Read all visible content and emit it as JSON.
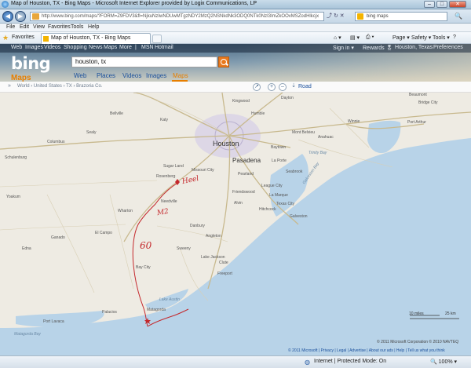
{
  "window": {
    "title": "Map of Houston, TX - Bing Maps - Microsoft Internet Explorer provided by Logix Communications, LP",
    "min": "–",
    "max": "□",
    "close": "✕"
  },
  "address": {
    "url": "http://www.bing.com/maps/?FORM=Z9FDV3&fl=NjkuNzIwNDUwMTgzNDY2MzQ2NSNkdNk3ODQ0NTk0NzI3ImZkOOvMSZodHlkcjx",
    "search_placeholder": "bing maps",
    "back": "◀",
    "forward": "▶",
    "go": "🔍",
    "tools": "⤴ ↻ ✕"
  },
  "menu": [
    "File",
    "Edit",
    "View",
    "Favorites",
    "Tools",
    "Help"
  ],
  "favorites": {
    "label": "Favorites",
    "tab_title": "Map of Houston, TX - Bing Maps",
    "commands": [
      "Page ▾",
      "Safety ▾",
      "Tools ▾",
      "?"
    ]
  },
  "bing": {
    "topnav": [
      "Web",
      "Images",
      "Videos",
      "Shopping",
      "News",
      "Maps",
      "More",
      "|",
      "MSN",
      "Hotmail"
    ],
    "right_links": [
      "Sign in ▾",
      "Rewards 🎖",
      "Houston, Texas",
      "Preferences"
    ],
    "logo": "bing",
    "section": "Maps",
    "query": "houston, tx",
    "verticals": [
      "Web",
      "Places",
      "Videos",
      "Images",
      "Maps"
    ]
  },
  "map_toolbar": {
    "breadcrumb": "World › United States › TX › Brazoria Co.",
    "road": "Road"
  },
  "map": {
    "cities": [
      {
        "name": "Houston",
        "big": true
      },
      {
        "name": "Pasadena",
        "big": true
      },
      {
        "name": "Baytown"
      },
      {
        "name": "La Porte"
      },
      {
        "name": "Sugar Land"
      },
      {
        "name": "Missouri City"
      },
      {
        "name": "Rosenberg"
      },
      {
        "name": "Pearland"
      },
      {
        "name": "League City"
      },
      {
        "name": "Friendswood"
      },
      {
        "name": "Texas City"
      },
      {
        "name": "Galveston"
      },
      {
        "name": "Alvin"
      },
      {
        "name": "Lake Jackson"
      },
      {
        "name": "Freeport"
      },
      {
        "name": "Bay City"
      },
      {
        "name": "El Campo"
      },
      {
        "name": "Wharton"
      },
      {
        "name": "Angleton"
      },
      {
        "name": "Kingwood"
      },
      {
        "name": "Dayton"
      },
      {
        "name": "Port Arthur"
      },
      {
        "name": "Bridge City"
      },
      {
        "name": "Winnie"
      },
      {
        "name": "Katy"
      },
      {
        "name": "Humble"
      },
      {
        "name": "Matagorda"
      },
      {
        "name": "Palacios"
      },
      {
        "name": "Port Lavaca"
      },
      {
        "name": "Beaumont"
      },
      {
        "name": "Needville"
      },
      {
        "name": "Sweeny"
      },
      {
        "name": "Danbury"
      },
      {
        "name": "Clute"
      },
      {
        "name": "Hitchcock"
      },
      {
        "name": "La Marque"
      },
      {
        "name": "Seabrook"
      },
      {
        "name": "Mont Belvieu"
      },
      {
        "name": "Anahuac"
      },
      {
        "name": "Sealy"
      },
      {
        "name": "Bellville"
      },
      {
        "name": "Columbus"
      },
      {
        "name": "Schulenburg"
      },
      {
        "name": "Yoakum"
      },
      {
        "name": "Edna"
      },
      {
        "name": "Ganado"
      }
    ],
    "water": [
      {
        "name": "Matagorda Bay"
      },
      {
        "name": "Galveston Bay"
      },
      {
        "name": "Lake Austin"
      },
      {
        "name": "Trinity Bay"
      }
    ],
    "annotations": [
      "Heel",
      "M2",
      "60"
    ],
    "scale": [
      "10 miles",
      "25 km"
    ],
    "copyright": "© 2011 Microsoft Corporation  © 2010 NAVTEQ",
    "footer_links": "© 2011 Microsoft  |  Privacy  |  Legal  |  Advertise  |  About our ads  |  Help  |  Tell us what you think"
  },
  "status": {
    "zone": "Internet | Protected Mode: On",
    "zoom": "🔍 100% ▾"
  }
}
